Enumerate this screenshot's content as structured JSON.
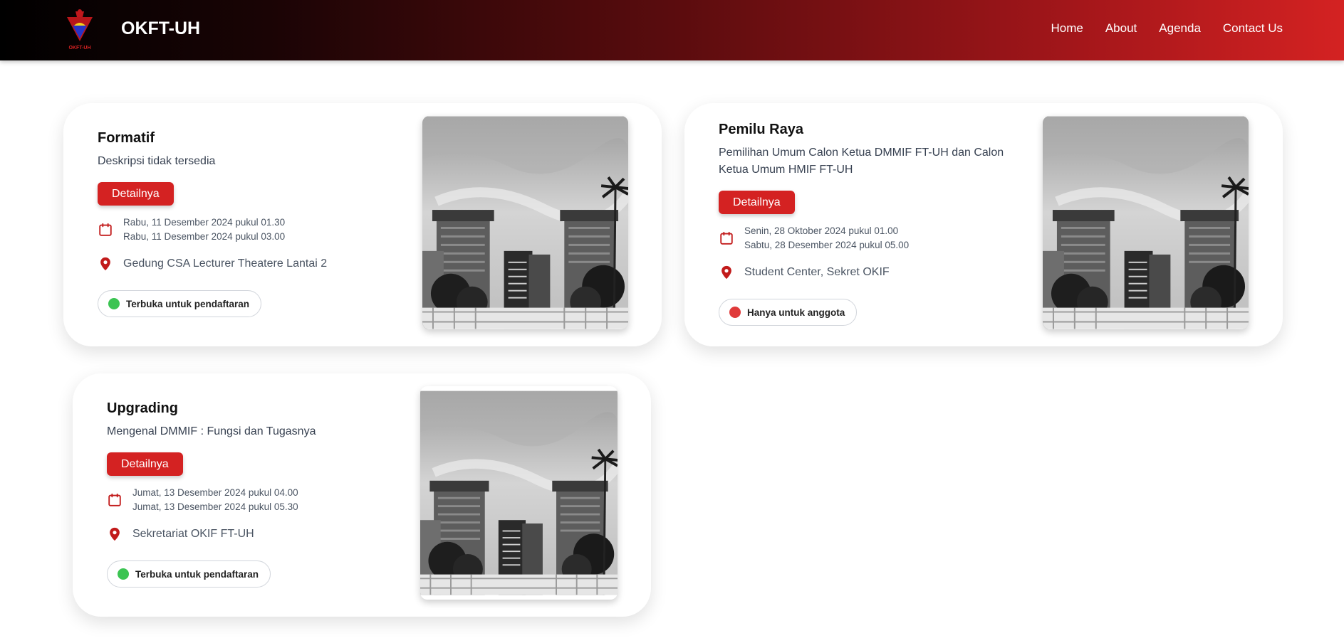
{
  "header": {
    "brand": "OKFT-UH",
    "nav": [
      "Home",
      "About",
      "Agenda",
      "Contact Us"
    ]
  },
  "colors": {
    "accent": "#d42222",
    "open": "#3bc452",
    "members": "#e03a3a"
  },
  "events": [
    {
      "title": "Formatif",
      "description": "Deskripsi tidak tersedia",
      "button": "Detailnya",
      "start": "Rabu, 11 Desember 2024 pukul 01.30",
      "end": "Rabu, 11 Desember 2024 pukul 03.00",
      "location": "Gedung CSA Lecturer Theatere Lantai 2",
      "status": "Terbuka untuk pendaftaran",
      "status_color": "green"
    },
    {
      "title": "Pemilu Raya",
      "description": "Pemilihan Umum Calon Ketua DMMIF FT-UH dan Calon Ketua Umum HMIF FT-UH",
      "button": "Detailnya",
      "start": "Senin, 28 Oktober 2024 pukul 01.00",
      "end": "Sabtu, 28 Desember 2024 pukul 05.00",
      "location": "Student Center, Sekret OKIF",
      "status": "Hanya untuk anggota",
      "status_color": "red"
    },
    {
      "title": "Upgrading",
      "description": "Mengenal DMMIF : Fungsi dan Tugasnya",
      "button": "Detailnya",
      "start": "Jumat, 13 Desember 2024 pukul 04.00",
      "end": "Jumat, 13 Desember 2024 pukul 05.30",
      "location": "Sekretariat OKIF FT-UH",
      "status": "Terbuka untuk pendaftaran",
      "status_color": "green"
    }
  ]
}
